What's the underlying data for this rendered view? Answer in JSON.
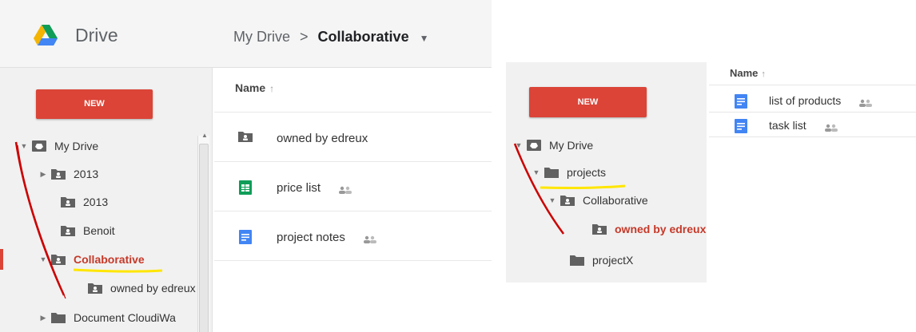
{
  "left": {
    "app": {
      "title": "Drive"
    },
    "breadcrumb": {
      "root": "My Drive",
      "separator": ">",
      "current": "Collaborative"
    },
    "new_button": "NEW",
    "tree": [
      {
        "label": "My Drive",
        "arrow": "▼",
        "icon": "my-drive-icon"
      },
      {
        "label": "2013",
        "arrow": "▶",
        "icon": "shared-folder-icon"
      },
      {
        "label": "2013",
        "arrow": "",
        "icon": "shared-folder-icon"
      },
      {
        "label": "Benoit",
        "arrow": "",
        "icon": "shared-folder-icon"
      },
      {
        "label": "Collaborative",
        "arrow": "▼",
        "icon": "shared-folder-icon",
        "active": true
      },
      {
        "label": "owned by edreux",
        "arrow": "",
        "icon": "shared-folder-icon"
      },
      {
        "label": "Document CloudiWa",
        "arrow": "▶",
        "icon": "folder-icon"
      }
    ],
    "list": {
      "header": "Name",
      "sort_indicator": "↑",
      "rows": [
        {
          "name": "owned by edreux",
          "icon": "shared-folder-icon",
          "shared": false
        },
        {
          "name": "price list",
          "icon": "sheets-icon",
          "shared": true
        },
        {
          "name": "project notes",
          "icon": "docs-icon",
          "shared": true
        }
      ]
    }
  },
  "right": {
    "new_button": "NEW",
    "tree": [
      {
        "label": "My Drive",
        "arrow": "▼",
        "icon": "my-drive-icon"
      },
      {
        "label": "projects",
        "arrow": "▼",
        "icon": "folder-icon"
      },
      {
        "label": "Collaborative",
        "arrow": "▼",
        "icon": "shared-folder-icon"
      },
      {
        "label": "owned by edreux",
        "arrow": "",
        "icon": "shared-folder-icon",
        "active": true
      },
      {
        "label": "projectX",
        "arrow": "",
        "icon": "folder-icon"
      }
    ],
    "list": {
      "header": "Name",
      "sort_indicator": "↑",
      "rows": [
        {
          "name": "list of products",
          "icon": "docs-icon",
          "shared": true
        },
        {
          "name": "task list",
          "icon": "docs-icon",
          "shared": true
        }
      ]
    }
  },
  "colors": {
    "new_button": "#db4437",
    "active_text": "#c53929",
    "annotation_red": "#cc0000",
    "annotation_yellow": "#ffe600",
    "sheets_green": "#0f9d58",
    "docs_blue": "#4285f4",
    "folder_gray": "#616161"
  }
}
